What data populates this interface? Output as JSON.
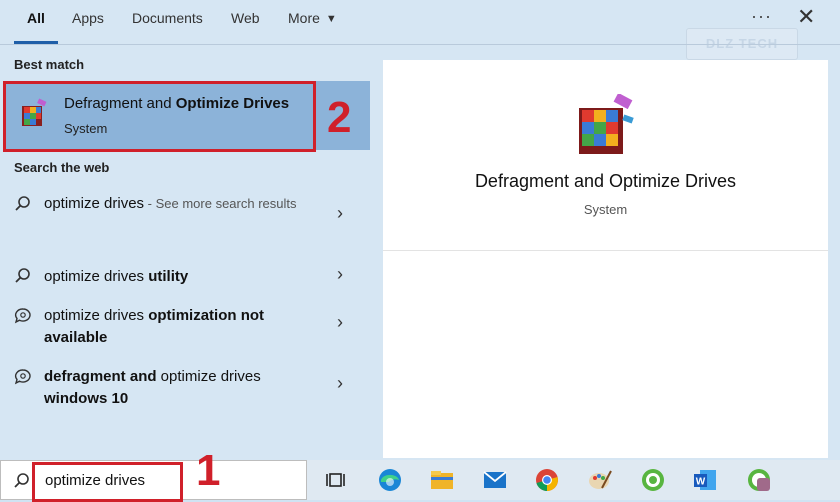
{
  "tabs": [
    {
      "label": "All",
      "active": true
    },
    {
      "label": "Apps"
    },
    {
      "label": "Documents"
    },
    {
      "label": "Web"
    },
    {
      "label": "More"
    }
  ],
  "watermark": "DLZ TECH",
  "best_match": {
    "section": "Best match",
    "title_plain": "Defragment and ",
    "title_bold": "Optimize Drives",
    "subtitle": "System"
  },
  "web": {
    "section": "Search the web",
    "results": [
      {
        "plain": "optimize drives",
        "bold": "",
        "suffix": " - See more search results"
      },
      {
        "plain": "optimize drives ",
        "bold": "utility",
        "suffix": ""
      },
      {
        "plain": "optimize drives ",
        "bold": "optimization not available",
        "suffix": ""
      },
      {
        "bold_first": "defragment and",
        "plain": " optimize drives ",
        "bold": "windows 10",
        "suffix": ""
      }
    ]
  },
  "preview": {
    "title": "Defragment and Optimize Drives",
    "subtitle": "System"
  },
  "search": {
    "value": "optimize drives"
  },
  "annotations": {
    "one": "1",
    "two": "2"
  },
  "icons": {
    "search": "search-icon",
    "task_view": "task-view-icon",
    "edge": "edge-icon",
    "explorer": "file-explorer-icon",
    "mail": "mail-icon",
    "chrome": "chrome-icon",
    "paint": "paint-icon",
    "app": "app-icon",
    "word": "word-icon",
    "app2": "app2-icon"
  },
  "colors": {
    "accent": "#1f5fa8",
    "highlight": "#8cb3d9",
    "annotation": "#d0202a"
  }
}
